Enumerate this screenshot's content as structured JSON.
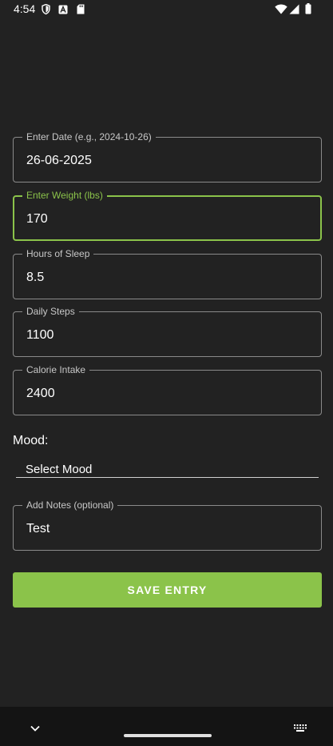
{
  "status_bar": {
    "time": "4:54",
    "left_icons": [
      "shield-icon",
      "a-box-icon",
      "sd-card-icon"
    ],
    "right_icons": [
      "wifi-icon",
      "cell-signal-icon",
      "battery-icon"
    ]
  },
  "form": {
    "date": {
      "label": "Enter Date (e.g., 2024-10-26)",
      "value": "26-06-2025"
    },
    "weight": {
      "label": "Enter Weight (lbs)",
      "value": "170"
    },
    "sleep": {
      "label": "Hours of Sleep",
      "value": "8.5"
    },
    "steps": {
      "label": "Daily Steps",
      "value": "1100"
    },
    "calories": {
      "label": "Calorie Intake",
      "value": "2400"
    },
    "mood": {
      "label": "Mood:",
      "value": "Select Mood"
    },
    "notes": {
      "label": "Add Notes (optional)",
      "value": "Test"
    },
    "save_label": "SAVE ENTRY"
  },
  "colors": {
    "accent": "#8bc34a",
    "background": "#222222",
    "nav_bar": "#141414"
  },
  "nav": {
    "left_icon": "chevron-down-icon",
    "right_icon": "keyboard-icon"
  }
}
